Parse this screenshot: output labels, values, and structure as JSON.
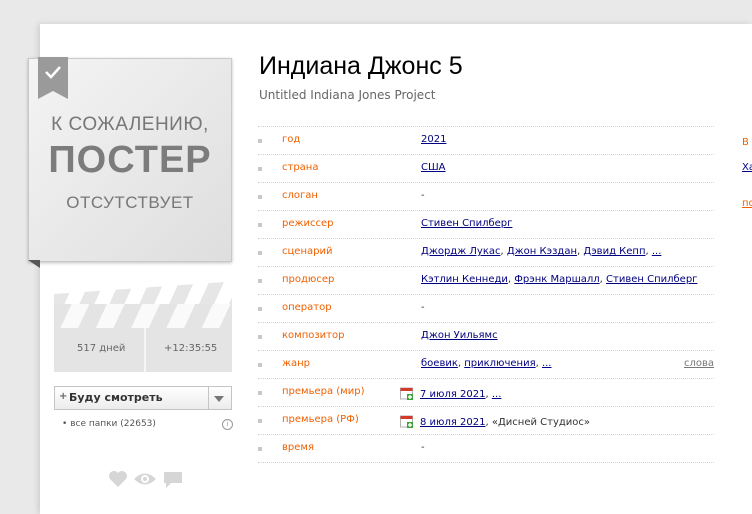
{
  "poster": {
    "line1": "К СОЖАЛЕНИЮ,",
    "line2": "ПОСТЕР",
    "line3": "ОТСУТСТВУЕТ"
  },
  "countdown": {
    "days": "517 дней",
    "time": "+12:35:55"
  },
  "watch_button": {
    "plus": "+",
    "label": "Буду смотреть"
  },
  "folders": {
    "bullet": "•",
    "label": "все папки (22653)"
  },
  "film": {
    "title": "Индиана Джонс 5",
    "original_title": "Untitled Indiana Jones Project"
  },
  "info_rows": [
    {
      "key": "год",
      "values": [
        "2021"
      ]
    },
    {
      "key": "страна",
      "values": [
        "США"
      ]
    },
    {
      "key": "слоган",
      "text": "-"
    },
    {
      "key": "режиссер",
      "values": [
        "Стивен Спилберг"
      ]
    },
    {
      "key": "сценарий",
      "values": [
        "Джордж Лукас",
        "Джон Кэздан",
        "Дэвид Кепп",
        "..."
      ]
    },
    {
      "key": "продюсер",
      "values": [
        "Кэтлин Кеннеди",
        "Фрэнк Маршалл",
        "Стивен Спилберг"
      ]
    },
    {
      "key": "оператор",
      "text": "-"
    },
    {
      "key": "композитор",
      "values": [
        "Джон Уильямс"
      ]
    },
    {
      "key": "жанр",
      "values": [
        "боевик",
        "приключения",
        "..."
      ],
      "extra": "слова"
    },
    {
      "key": "премьера (мир)",
      "values": [
        "7 июля 2021",
        "..."
      ],
      "calendar": true
    },
    {
      "key": "премьера (РФ)",
      "values": [
        "8 июля 2021"
      ],
      "suffix": ", «Дисней Студиос»",
      "calendar": true
    },
    {
      "key": "время",
      "text": "-"
    }
  ],
  "right_edge": {
    "text1": "В",
    "text2": "Ха",
    "text3": "по"
  },
  "colors": {
    "key": "#f06000",
    "link": "#000080"
  }
}
